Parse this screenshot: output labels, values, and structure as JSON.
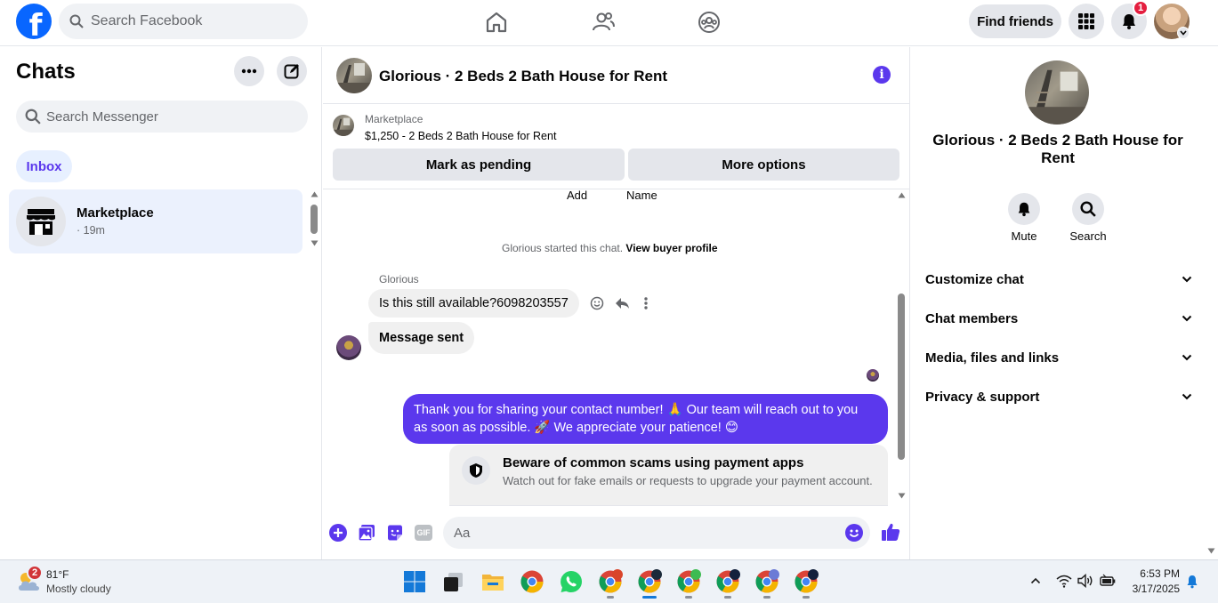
{
  "topbar": {
    "logo_letter": "f",
    "search_placeholder": "Search Facebook",
    "find_friends": "Find friends",
    "notif_count": "1"
  },
  "left": {
    "title": "Chats",
    "search_placeholder": "Search Messenger",
    "inbox": "Inbox",
    "conversations": [
      {
        "name": "Marketplace",
        "time": "· 19m"
      }
    ]
  },
  "chat": {
    "title": "Glorious · 2 Beds 2 Bath House for Rent",
    "marketplace_label": "Marketplace",
    "listing": "$1,250 - 2 Beds 2 Bath House for Rent",
    "mark_pending": "Mark as pending",
    "more_options": "More options",
    "cut_labels": [
      "Add",
      "Name"
    ],
    "system_text": "Glorious started this chat.",
    "system_link": "View buyer profile",
    "sender": "Glorious",
    "msg1": "Is this still available?6098203557",
    "msg2": "Message sent",
    "reply_line1": "Thank you for sharing your contact number! 🙏 Our team will reach out to you",
    "reply_line2": "as soon as possible. 🚀 We appreciate your patience! 😊",
    "scam_title": "Beware of common scams using payment apps",
    "scam_body": "Watch out for fake emails or requests to upgrade your payment account.",
    "composer_placeholder": "Aa",
    "gif_label": "GIF"
  },
  "right": {
    "title": "Glorious · 2 Beds 2 Bath House for Rent",
    "mute": "Mute",
    "search": "Search",
    "sections": [
      "Customize chat",
      "Chat members",
      "Media, files and links",
      "Privacy & support"
    ]
  },
  "taskbar": {
    "weather_badge": "2",
    "temp": "81°F",
    "condition": "Mostly cloudy",
    "time": "6:53 PM",
    "date": "3/17/2025"
  },
  "colors": {
    "accent": "#5b38ed",
    "fb_blue": "#0866ff",
    "badge_red": "#e41e3f"
  }
}
